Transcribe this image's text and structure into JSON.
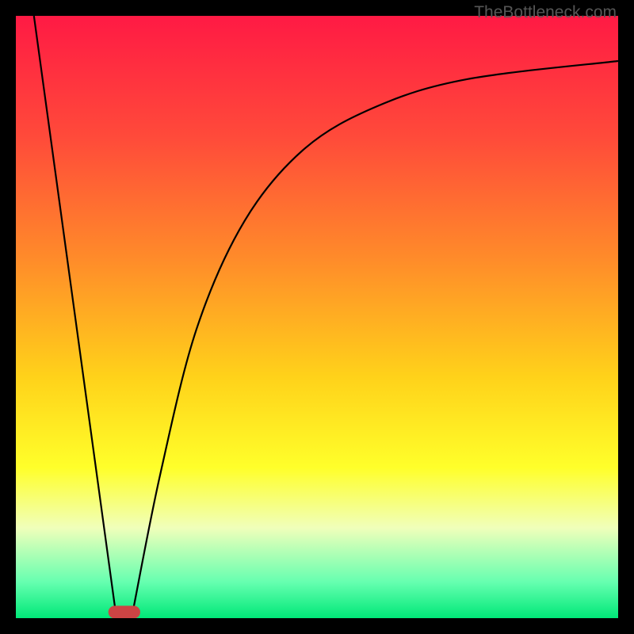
{
  "watermark": "TheBottleneck.com",
  "chart_data": {
    "type": "line",
    "title": "",
    "xlabel": "",
    "ylabel": "",
    "xlim": [
      0,
      100
    ],
    "ylim": [
      0,
      100
    ],
    "gradient_stops": [
      {
        "offset": 0,
        "color": "#ff1a44"
      },
      {
        "offset": 20,
        "color": "#ff4a3a"
      },
      {
        "offset": 40,
        "color": "#ff8a2a"
      },
      {
        "offset": 60,
        "color": "#ffd21a"
      },
      {
        "offset": 75,
        "color": "#ffff2a"
      },
      {
        "offset": 85,
        "color": "#f0ffba"
      },
      {
        "offset": 94,
        "color": "#66ffb0"
      },
      {
        "offset": 100,
        "color": "#00e878"
      }
    ],
    "series": [
      {
        "name": "left-line",
        "type": "line",
        "points": [
          {
            "x": 3,
            "y": 100
          },
          {
            "x": 16.5,
            "y": 1.5
          }
        ]
      },
      {
        "name": "right-curve",
        "type": "curve",
        "points": [
          {
            "x": 19.5,
            "y": 1.5
          },
          {
            "x": 24,
            "y": 24
          },
          {
            "x": 30,
            "y": 48
          },
          {
            "x": 38,
            "y": 66
          },
          {
            "x": 48,
            "y": 78
          },
          {
            "x": 60,
            "y": 85
          },
          {
            "x": 75,
            "y": 89.5
          },
          {
            "x": 100,
            "y": 92.5
          }
        ]
      }
    ],
    "marker": {
      "x": 18,
      "y": 1,
      "width": 5.3,
      "height": 2.1,
      "color": "#cc4444"
    }
  }
}
